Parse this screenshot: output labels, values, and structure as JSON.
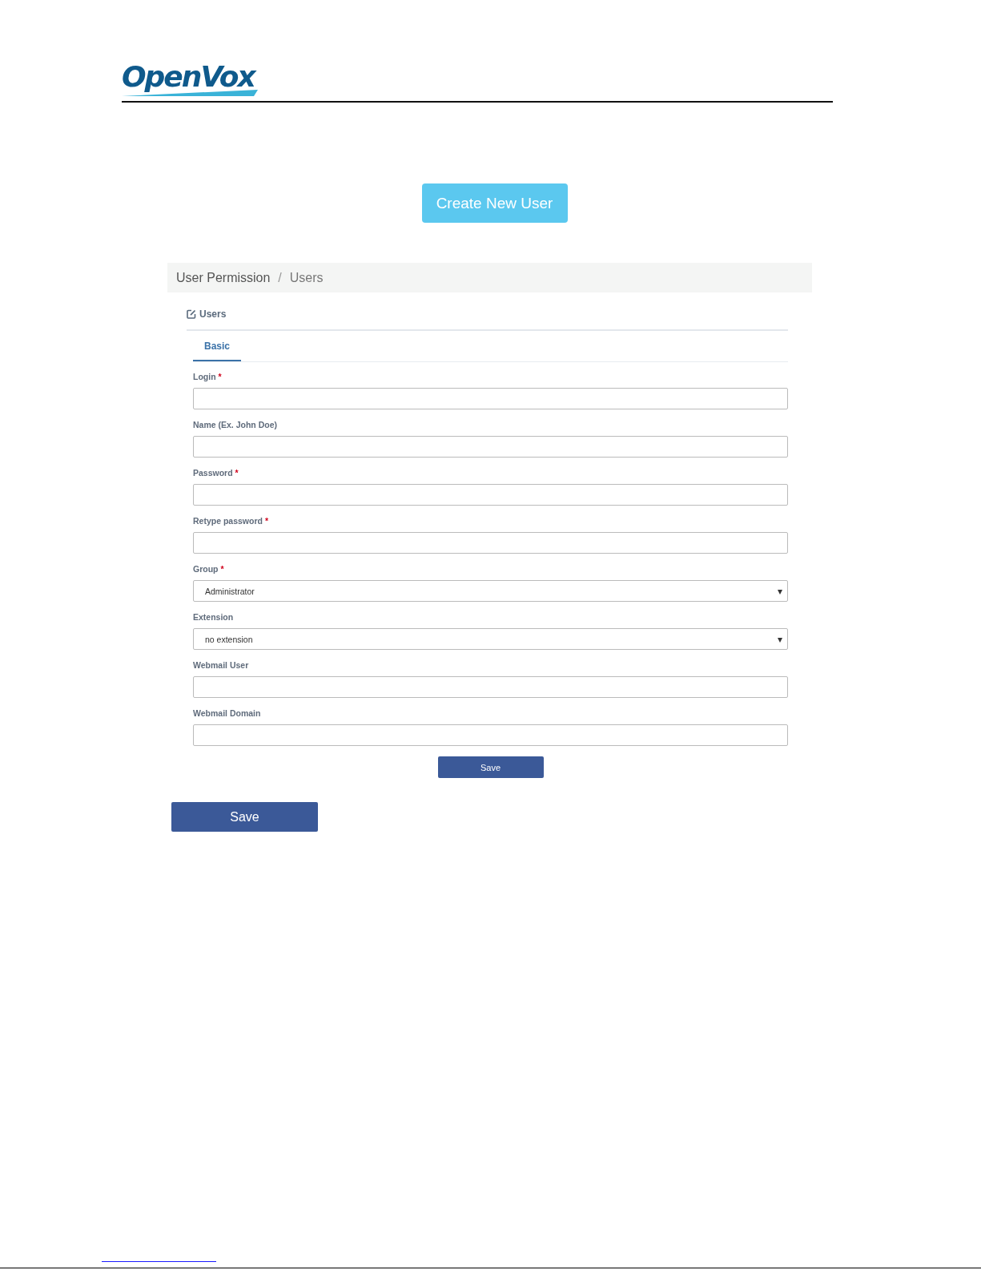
{
  "logo": {
    "text": "OpenVox"
  },
  "create_button": {
    "label": "Create New User"
  },
  "breadcrumb": {
    "items": [
      "User Permission",
      "Users"
    ],
    "separator": "/"
  },
  "panel": {
    "title": "Users",
    "tabs": [
      {
        "label": "Basic",
        "selected": true
      }
    ],
    "fields": [
      {
        "kind": "input",
        "label": "Login",
        "required_mark": "*"
      },
      {
        "kind": "input",
        "label": "Name (Ex. John Doe)"
      },
      {
        "kind": "input",
        "label": "Password",
        "required_mark": "*"
      },
      {
        "kind": "input",
        "label": "Retype password",
        "required_mark": "*"
      },
      {
        "kind": "select",
        "label": "Group",
        "required_mark": "*",
        "value": "Administrator",
        "caret": "▾"
      },
      {
        "kind": "select",
        "label": "Extension",
        "value": "no extension",
        "caret": "▾"
      },
      {
        "kind": "input",
        "label": "Webmail User"
      },
      {
        "kind": "input",
        "label": "Webmail Domain"
      }
    ],
    "save_button": {
      "label": "Save"
    }
  },
  "save_button": {
    "label": "Save"
  }
}
